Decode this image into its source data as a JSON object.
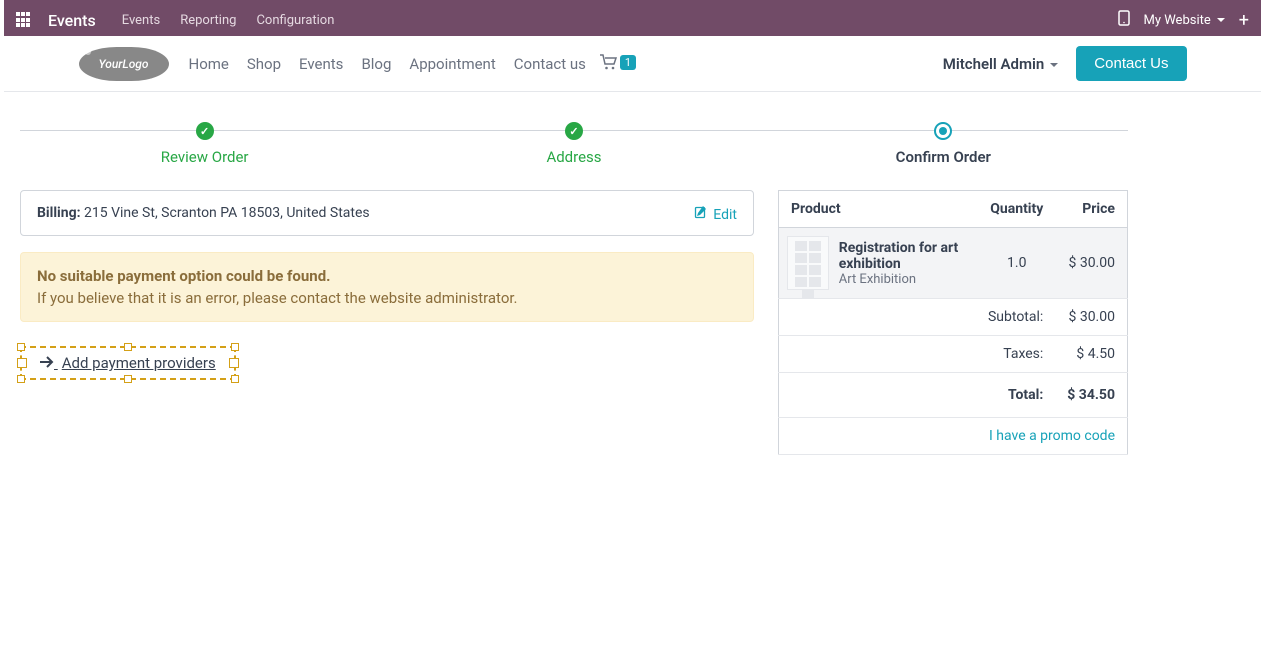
{
  "admin": {
    "app_name": "Events",
    "menu": [
      "Events",
      "Reporting",
      "Configuration"
    ],
    "website_switch": "My Website",
    "plus": "+"
  },
  "header": {
    "logo_text": "YourLogo",
    "nav": [
      "Home",
      "Shop",
      "Events",
      "Blog",
      "Appointment",
      "Contact us"
    ],
    "cart_count": "1",
    "user": "Mitchell Admin",
    "contact_btn": "Contact Us"
  },
  "steps": {
    "review": "Review Order",
    "address": "Address",
    "confirm": "Confirm Order"
  },
  "billing": {
    "label": "Billing:",
    "address": "215 Vine St, Scranton PA 18503, United States",
    "edit": "Edit"
  },
  "alert": {
    "title": "No suitable payment option could be found.",
    "body": "If you believe that it is an error, please contact the website administrator."
  },
  "add_providers": "Add payment providers",
  "order": {
    "headers": {
      "product": "Product",
      "quantity": "Quantity",
      "price": "Price"
    },
    "product": {
      "name": "Registration for art exhibition",
      "sub": "Art Exhibition",
      "qty": "1.0",
      "price": "$ 30.00"
    },
    "subtotal_label": "Subtotal:",
    "subtotal": "$ 30.00",
    "taxes_label": "Taxes:",
    "taxes": "$ 4.50",
    "total_label": "Total:",
    "total": "$ 34.50",
    "promo": "I have a promo code"
  }
}
